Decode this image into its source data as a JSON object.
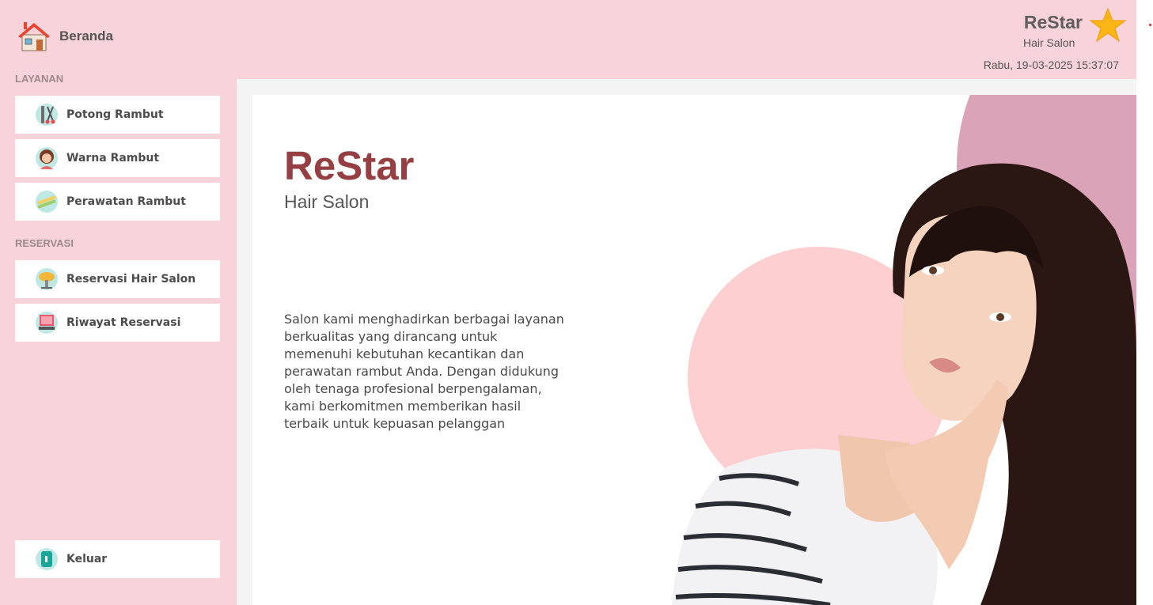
{
  "header": {
    "home_label": "Beranda",
    "brand_title": "ReStar",
    "brand_subtitle": "Hair Salon",
    "datetime": "Rabu, 19-03-2025 15:37:07"
  },
  "sidebar": {
    "layanan_label": "LAYANAN",
    "layanan_items": [
      {
        "label": "Potong Rambut",
        "icon": "scissors-comb-icon"
      },
      {
        "label": "Warna Rambut",
        "icon": "woman-face-icon"
      },
      {
        "label": "Perawatan Rambut",
        "icon": "hair-straightener-icon"
      }
    ],
    "reservasi_label": "RESERVASI",
    "reservasi_items": [
      {
        "label": "Reservasi Hair Salon",
        "icon": "hair-dryer-icon"
      },
      {
        "label": "Riwayat Reservasi",
        "icon": "salon-chair-icon"
      }
    ],
    "logout_label": "Keluar",
    "logout_icon": "exit-door-icon"
  },
  "main": {
    "title": "ReStar",
    "subtitle": "Hair Salon",
    "description": "Salon kami menghadirkan berbagai layanan berkualitas yang dirancang untuk memenuhi kebutuhan kecantikan dan perawatan rambut Anda. Dengan didukung oleh tenaga profesional berpengalaman, kami berkomitmen memberikan hasil terbaik untuk kepuasan pelanggan"
  },
  "colors": {
    "background_pink": "#f9d3da",
    "title_maroon": "#953f42",
    "circle_mauve": "#dba3b7",
    "circle_pink": "#fdcfd1",
    "star_gold": "#fbb616"
  }
}
